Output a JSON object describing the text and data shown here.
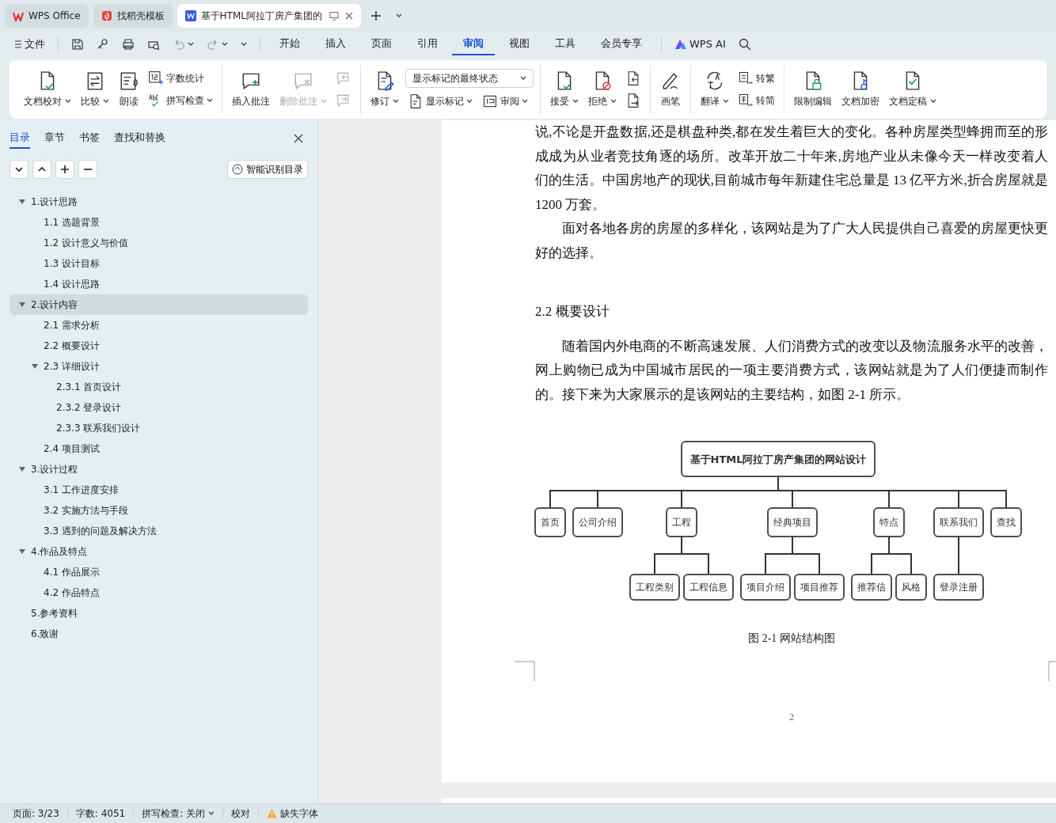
{
  "window_tabs": [
    {
      "label": "WPS Office",
      "kind": "home",
      "selected": false
    },
    {
      "label": "找稻壳模板",
      "kind": "template",
      "selected": false
    },
    {
      "label": "基于HTML阿拉丁房产集团的",
      "kind": "document",
      "selected": true
    }
  ],
  "menu": {
    "file": "文件",
    "tabs": [
      {
        "label": "开始",
        "selected": false
      },
      {
        "label": "插入",
        "selected": false
      },
      {
        "label": "页面",
        "selected": false
      },
      {
        "label": "引用",
        "selected": false
      },
      {
        "label": "审阅",
        "selected": true
      },
      {
        "label": "视图",
        "selected": false
      },
      {
        "label": "工具",
        "selected": false
      },
      {
        "label": "会员专享",
        "selected": false
      }
    ],
    "ai": "WPS AI"
  },
  "ribbon": [
    {
      "items": [
        {
          "kind": "big",
          "label": "文档校对",
          "caret": true,
          "disabled": false
        },
        {
          "kind": "big",
          "label": "比较",
          "caret": true,
          "disabled": false
        },
        {
          "kind": "big",
          "label": "朗读",
          "caret": false,
          "disabled": false
        },
        {
          "kind": "stack",
          "rows": [
            [
              {
                "kind": "small",
                "label": "字数统计",
                "caret": false,
                "disabled": false
              }
            ],
            [
              {
                "kind": "small",
                "label": "拼写检查",
                "caret": true,
                "disabled": false
              }
            ]
          ]
        }
      ]
    },
    {
      "items": [
        {
          "kind": "big",
          "label": "插入批注",
          "caret": false,
          "disabled": false
        },
        {
          "kind": "big",
          "label": "删除批注",
          "caret": true,
          "disabled": true
        },
        {
          "kind": "stack",
          "rows": [
            [
              {
                "kind": "small",
                "caret": false,
                "disabled": true
              }
            ],
            [
              {
                "kind": "small",
                "caret": false,
                "disabled": true
              }
            ]
          ]
        }
      ]
    },
    {
      "items": [
        {
          "kind": "big",
          "label": "修订",
          "caret": true,
          "disabled": false
        },
        {
          "kind": "stack",
          "rows": [
            [
              {
                "kind": "select",
                "value": "显示标记的最终状态"
              }
            ],
            [
              {
                "kind": "small",
                "label": "显示标记",
                "caret": true,
                "disabled": false
              },
              {
                "kind": "small",
                "label": "审阅",
                "caret": true,
                "disabled": false
              }
            ]
          ]
        }
      ]
    },
    {
      "items": [
        {
          "kind": "big",
          "label": "接受",
          "caret": true,
          "disabled": false
        },
        {
          "kind": "big",
          "label": "拒绝",
          "caret": true,
          "disabled": false
        },
        {
          "kind": "stack",
          "rows": [
            [
              {
                "kind": "small",
                "caret": false,
                "disabled": false
              }
            ],
            [
              {
                "kind": "small",
                "caret": false,
                "disabled": false
              }
            ]
          ]
        }
      ]
    },
    {
      "items": [
        {
          "kind": "big",
          "label": "画笔",
          "caret": false,
          "disabled": false
        }
      ]
    },
    {
      "items": [
        {
          "kind": "big",
          "label": "翻译",
          "caret": true,
          "disabled": false
        },
        {
          "kind": "stack",
          "rows": [
            [
              {
                "kind": "small",
                "label": "转繁",
                "caret": false,
                "disabled": false
              }
            ],
            [
              {
                "kind": "small",
                "label": "转简",
                "caret": false,
                "disabled": false
              }
            ]
          ]
        }
      ]
    },
    {
      "items": [
        {
          "kind": "big",
          "label": "限制编辑",
          "caret": false,
          "disabled": false
        },
        {
          "kind": "big",
          "label": "文档加密",
          "caret": false,
          "disabled": false
        },
        {
          "kind": "big",
          "label": "文档定稿",
          "caret": true,
          "disabled": false
        }
      ]
    }
  ],
  "nav_panel": {
    "tabs": [
      {
        "label": "目录",
        "selected": true
      },
      {
        "label": "章节",
        "selected": false
      },
      {
        "label": "书签",
        "selected": false
      },
      {
        "label": "查找和替换",
        "selected": false
      }
    ],
    "smart_button": "智能识别目录",
    "toc": [
      {
        "label": "1.设计思路",
        "selected": false,
        "expanded": true,
        "children": [
          {
            "label": "1.1 选题背景",
            "selected": false
          },
          {
            "label": "1.2 设计意义与价值",
            "selected": false
          },
          {
            "label": "1.3 设计目标",
            "selected": false
          },
          {
            "label": "1.4 设计思路",
            "selected": false
          }
        ]
      },
      {
        "label": "2.设计内容",
        "selected": true,
        "expanded": true,
        "children": [
          {
            "label": "2.1 需求分析",
            "selected": false
          },
          {
            "label": "2.2 概要设计",
            "selected": false
          },
          {
            "label": "2.3 详细设计",
            "selected": false,
            "expanded": true,
            "children": [
              {
                "label": "2.3.1 首页设计",
                "selected": false
              },
              {
                "label": "2.3.2 登录设计",
                "selected": false
              },
              {
                "label": "2.3.3 联系我们设计",
                "selected": false
              }
            ]
          },
          {
            "label": "2.4 项目测试",
            "selected": false
          }
        ]
      },
      {
        "label": "3.设计过程",
        "selected": false,
        "expanded": true,
        "children": [
          {
            "label": "3.1 工作进度安排",
            "selected": false
          },
          {
            "label": "3.2 实施方法与手段",
            "selected": false
          },
          {
            "label": "3.3 遇到的问题及解决方法",
            "selected": false
          }
        ]
      },
      {
        "label": "4.作品及特点",
        "selected": false,
        "expanded": true,
        "children": [
          {
            "label": "4.1 作品展示",
            "selected": false
          },
          {
            "label": "4.2 作品特点",
            "selected": false
          }
        ]
      },
      {
        "label": "5.参考资料",
        "selected": false
      },
      {
        "label": "6.致谢",
        "selected": false
      }
    ]
  },
  "document": {
    "blocks": [
      {
        "kind": "paragraph",
        "indent": false,
        "text": "说,不论是开盘数据,还是棋盘种类,都在发生着巨大的变化。各种房屋类型蜂拥而至的形成成为从业者竞技角逐的场所。改革开放二十年来,房地产业从未像今天一样改变着人们的生活。中国房地产的现状,目前城市每年新建住宅总量是 13 亿平方米,折合房屋就是 1200 万套。"
      },
      {
        "kind": "paragraph",
        "indent": true,
        "text": "面对各地各房的房屋的多样化，该网站是为了广大人民提供自己喜爱的房屋更快更好的选择。"
      },
      {
        "kind": "heading",
        "text": "2.2 概要设计"
      },
      {
        "kind": "paragraph",
        "indent": true,
        "text": "随着国内外电商的不断高速发展、人们消费方式的改变以及物流服务水平的改善，网上购物已成为中国城市居民的一项主要消费方式，该网站就是为了人们便捷而制作的。接下来为大家展示的是该网站的主要结构，如图 2-1 所示。"
      }
    ],
    "diagram": {
      "label": "基于HTML阿拉丁房产集团的网站设计",
      "children": [
        {
          "label": "首页"
        },
        {
          "label": "公司介绍"
        },
        {
          "label": "工程",
          "children": [
            {
              "label": "工程类别"
            },
            {
              "label": "工程信息"
            }
          ]
        },
        {
          "label": "经典项目",
          "children": [
            {
              "label": "项目介绍"
            },
            {
              "label": "项目推荐"
            }
          ]
        },
        {
          "label": "特点",
          "children": [
            {
              "label": "推荐信"
            },
            {
              "label": "风格"
            }
          ]
        },
        {
          "label": "联系我们",
          "children": [
            {
              "label": "登录注册"
            }
          ]
        },
        {
          "label": "查找"
        }
      ]
    },
    "caption": "图 2-1  网站结构图",
    "page_number": "2"
  },
  "status_bar": [
    {
      "label": "页面: 3/23",
      "kind": "text",
      "caret": false
    },
    {
      "label": "字数: 4051",
      "kind": "text",
      "caret": false
    },
    {
      "label": "拼写检查: 关闭",
      "kind": "menu",
      "caret": true
    },
    {
      "label": "校对",
      "kind": "button",
      "caret": false
    },
    {
      "label": "缺失字体",
      "kind": "warning",
      "caret": false
    }
  ]
}
